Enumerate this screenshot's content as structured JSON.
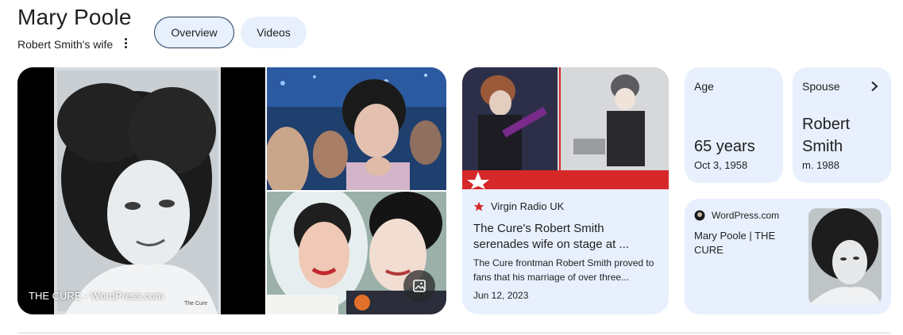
{
  "header": {
    "title": "Mary Poole",
    "subtitle": "Robert Smith's wife",
    "more_icon": "more-vert-icon",
    "tabs": [
      {
        "label": "Overview",
        "active": true
      },
      {
        "label": "Videos",
        "active": false
      }
    ]
  },
  "images": {
    "main_caption": "THE CURE - WordPress.com",
    "gallery_icon": "image-gallery-icon"
  },
  "news": {
    "source": "Virgin Radio UK",
    "source_icon": "red-star-icon",
    "headline": "The Cure's Robert Smith serenades wife on stage at ...",
    "snippet": "The Cure frontman Robert Smith proved to fans that his marriage of over three...",
    "date": "Jun 12, 2023"
  },
  "facts": {
    "age": {
      "label": "Age",
      "value": "65 years",
      "sub": "Oct 3, 1958"
    },
    "spouse": {
      "label": "Spouse",
      "value_line1": "Robert",
      "value_line2": "Smith",
      "sub": "m. 1988",
      "icon": "chevron-right-icon"
    }
  },
  "wordpress": {
    "source": "WordPress.com",
    "title": "Mary Poole | THE CURE"
  },
  "colors": {
    "card_bg": "#e8f0fe",
    "active_chip_border": "#1f3b5b",
    "accent_red": "#d62828"
  }
}
